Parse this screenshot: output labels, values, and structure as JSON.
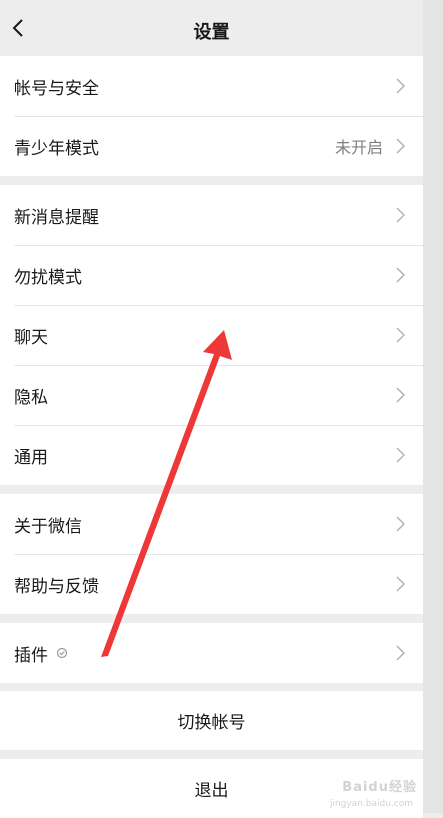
{
  "header": {
    "title": "设置",
    "back_icon": "chevron-left-icon"
  },
  "groups": [
    {
      "items": [
        {
          "label": "帐号与安全",
          "value": ""
        },
        {
          "label": "青少年模式",
          "value": "未开启"
        }
      ]
    },
    {
      "items": [
        {
          "label": "新消息提醒",
          "value": ""
        },
        {
          "label": "勿扰模式",
          "value": ""
        },
        {
          "label": "聊天",
          "value": ""
        },
        {
          "label": "隐私",
          "value": ""
        },
        {
          "label": "通用",
          "value": ""
        }
      ]
    },
    {
      "items": [
        {
          "label": "关于微信",
          "value": ""
        },
        {
          "label": "帮助与反馈",
          "value": ""
        }
      ]
    },
    {
      "items": [
        {
          "label": "插件",
          "value": "",
          "icon": "plugin-icon"
        }
      ]
    }
  ],
  "actions": {
    "switch_account": "切换帐号",
    "logout": "退出"
  },
  "watermark": {
    "text": "Baidu经验",
    "sub": "jingyan.baidu.com"
  },
  "colors": {
    "background": "#ededed",
    "arrow": "#ee3838",
    "chevron": "#b2b2b2"
  }
}
